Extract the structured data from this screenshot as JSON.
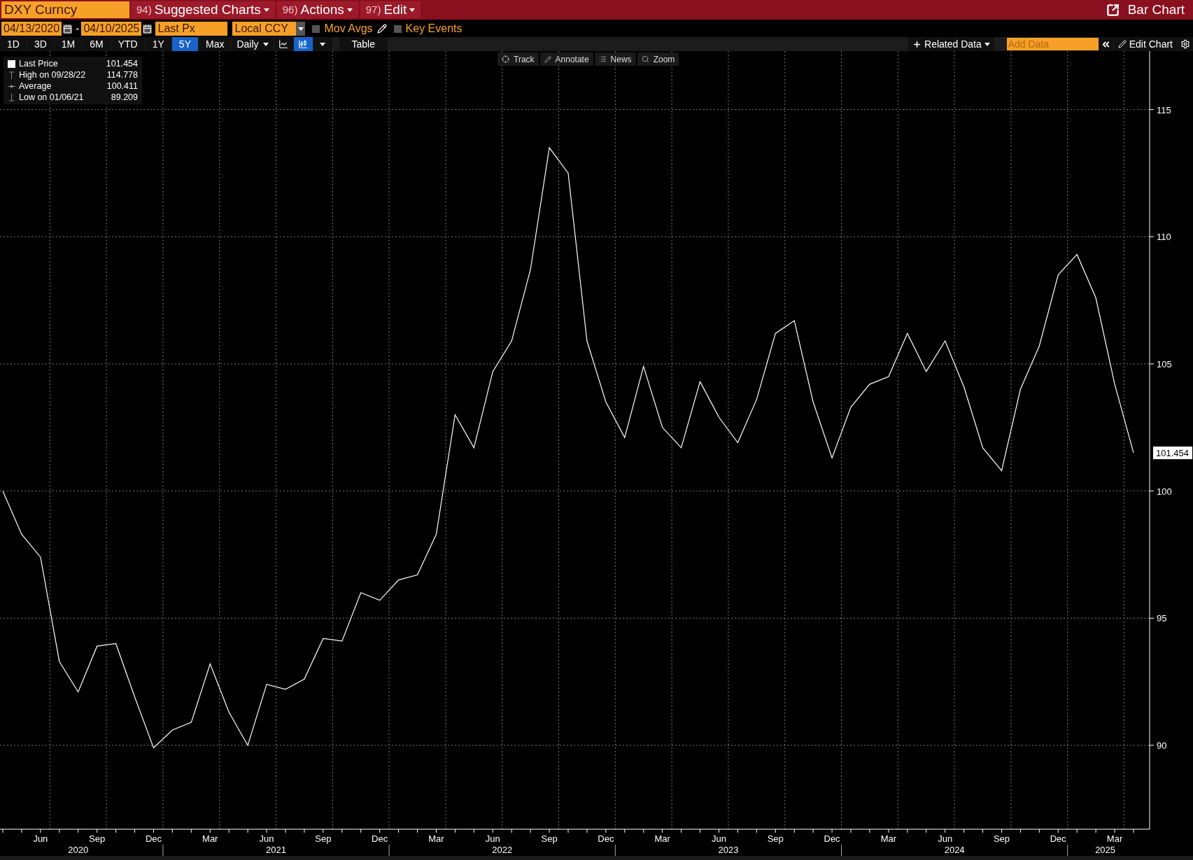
{
  "header": {
    "security": "DXY Curncy",
    "menus": [
      {
        "number": "94)",
        "label": "Suggested Charts"
      },
      {
        "number": "96)",
        "label": "Actions"
      },
      {
        "number": "97)",
        "label": "Edit"
      }
    ],
    "chart_type": "Bar Chart"
  },
  "settings": {
    "start_date": "04/13/2020",
    "separator": "-",
    "end_date": "04/10/2025",
    "field": "Last Px",
    "currency": "Local CCY",
    "options": [
      {
        "label": "Mov Avgs",
        "checked": false,
        "kind": "edit"
      },
      {
        "label": "Key Events",
        "checked": false,
        "kind": "plain"
      }
    ]
  },
  "ranges": [
    {
      "label": "1D",
      "selected": false
    },
    {
      "label": "3D",
      "selected": false
    },
    {
      "label": "1M",
      "selected": false
    },
    {
      "label": "6M",
      "selected": false
    },
    {
      "label": "YTD",
      "selected": false
    },
    {
      "label": "1Y",
      "selected": false
    },
    {
      "label": "5Y",
      "selected": true
    },
    {
      "label": "Max",
      "selected": false
    }
  ],
  "frequency": "Daily",
  "chart_styles": [
    {
      "kind": "line",
      "selected": false
    },
    {
      "kind": "bar",
      "selected": true
    }
  ],
  "table_button": "Table",
  "related_data": "Related Data",
  "add_data": {
    "placeholder": "Add Data"
  },
  "edit_chart": "Edit Chart",
  "chart_tools": [
    {
      "kind": "track",
      "label": "Track"
    },
    {
      "kind": "annotate",
      "label": "Annotate"
    },
    {
      "kind": "news",
      "label": "News"
    },
    {
      "kind": "zoom",
      "label": "Zoom"
    }
  ],
  "legend": [
    {
      "kind": "last",
      "label": "Last Price",
      "value": "101.454"
    },
    {
      "kind": "high",
      "label": "High on 09/28/22",
      "value": "114.778"
    },
    {
      "kind": "average",
      "label": "Average",
      "value": "100.411"
    },
    {
      "kind": "low",
      "label": "Low on 01/06/21",
      "value": "89.209"
    }
  ],
  "chart": {
    "last_label": "101.454",
    "years": [
      "2020",
      "2021",
      "2022",
      "2023",
      "2024",
      "2025"
    ],
    "chart_data": {
      "type": "line",
      "categories": [
        null,
        null,
        "Jun",
        null,
        null,
        "Sep",
        null,
        null,
        "Dec",
        null,
        null,
        "Mar",
        null,
        null,
        "Jun",
        null,
        null,
        "Sep",
        null,
        null,
        "Dec",
        null,
        null,
        "Mar",
        null,
        null,
        "Jun",
        null,
        null,
        "Sep",
        null,
        null,
        "Dec",
        null,
        null,
        "Mar",
        null,
        null,
        "Jun",
        null,
        null,
        "Sep",
        null,
        null,
        "Dec",
        null,
        null,
        "Mar",
        null,
        null,
        "Jun",
        null,
        null,
        "Sep",
        null,
        null,
        "Dec",
        null,
        null,
        "Mar",
        null
      ],
      "series": [
        {
          "color": "#ffffff",
          "values": [
            100.0,
            98.3,
            97.4,
            93.3,
            92.1,
            93.9,
            94.0,
            91.9,
            89.9,
            90.6,
            90.9,
            93.2,
            91.3,
            90.0,
            92.4,
            92.2,
            92.6,
            94.2,
            94.1,
            96.0,
            95.7,
            96.5,
            96.7,
            98.3,
            103.0,
            101.7,
            104.7,
            105.9,
            108.7,
            113.5,
            112.5,
            105.9,
            103.5,
            102.1,
            104.9,
            102.5,
            101.7,
            104.3,
            102.9,
            101.9,
            103.6,
            106.2,
            106.7,
            103.5,
            101.3,
            103.3,
            104.2,
            104.5,
            106.2,
            104.7,
            105.9,
            104.1,
            101.7,
            100.8,
            104.0,
            105.7,
            108.5,
            109.3,
            107.6,
            104.2,
            101.5
          ]
        }
      ],
      "ylim": [
        86.7,
        117.3
      ],
      "grid": true,
      "yticks": [
        90,
        95,
        100,
        105,
        110,
        115
      ]
    }
  }
}
